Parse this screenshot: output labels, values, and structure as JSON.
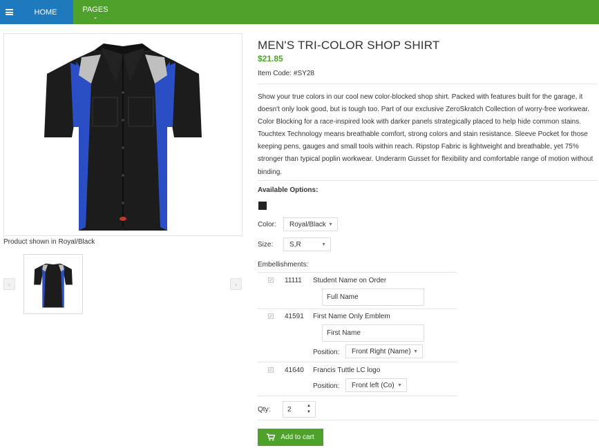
{
  "nav": {
    "menu_icon": "hamburger-icon",
    "home_label": "HOME",
    "pages_label": "PAGES",
    "pages_chevron": "⌄"
  },
  "gallery": {
    "caption": "Product shown in Royal/Black",
    "prev_label": "‹",
    "next_label": "›"
  },
  "product": {
    "title": "MEN'S TRI-COLOR SHOP SHIRT",
    "price": "$21.85",
    "item_code_label": "Item Code:",
    "item_code": "#SY28",
    "description": "Show your true colors in our cool new color-blocked shop shirt. Packed with features built for the garage, it doesn't only look good, but is tough too. Part of our exclusive ZeroSkratch Collection of worry-free workwear. Color Blocking for a race-inspired look with darker panels strategically placed to help hide common stains. Touchtex Technology means breathable comfort, strong colors and stain resistance. Sleeve Pocket for those keeping pens, gauges and small tools within reach. Ripstop Fabric is lightweight and breathable, yet 75% stronger than typical poplin workwear. Underarm Gusset for flexibility and comfortable range of motion without binding."
  },
  "options": {
    "heading": "Available Options:",
    "swatch_color": "#222222",
    "color_label": "Color:",
    "color_value": "Royal/Black",
    "size_label": "Size:",
    "size_value": "S,R",
    "embellishments_label": "Embellishments:",
    "embellishments": [
      {
        "code": "11111",
        "name": "Student Name on Order",
        "placeholder": "Full Name"
      },
      {
        "code": "41591",
        "name": "First Name Only Emblem",
        "placeholder": "First Name",
        "position_label": "Position:",
        "position_value": "Front Right (Name)"
      },
      {
        "code": "41640",
        "name": "Francis Tuttle LC logo",
        "position_label": "Position:",
        "position_value": "Front left (Co)"
      }
    ],
    "qty_label": "Qty:",
    "qty_value": "2",
    "add_to_cart": "Add to cart"
  },
  "colors": {
    "nav_green": "#4ea22b",
    "nav_blue": "#1f7abd",
    "shirt_black": "#1c1c1c",
    "shirt_blue": "#2a4fc4",
    "shirt_gray": "#bfbfbf"
  }
}
